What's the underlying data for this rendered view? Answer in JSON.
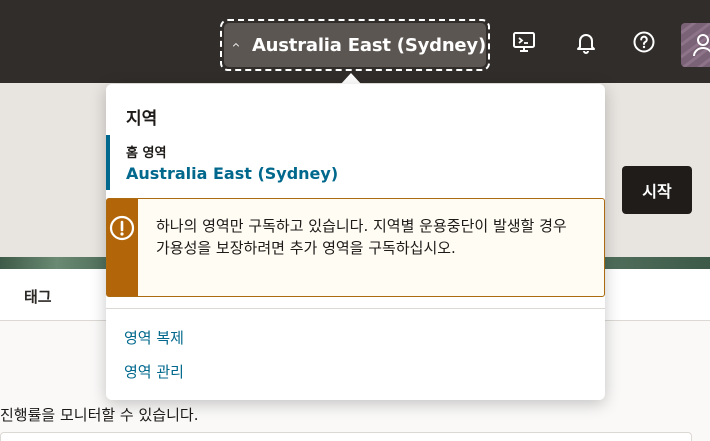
{
  "header": {
    "region_selector": {
      "label": "Australia East (Sydney)"
    },
    "icons": [
      "cloud-shell-icon",
      "bell-icon",
      "help-icon",
      "avatar"
    ]
  },
  "background": {
    "start_button": "시작",
    "tab_tags": "태그",
    "monitor_text": "진행률을 모니터할 수 있습니다."
  },
  "region_popover": {
    "title": "지역",
    "home_region_label": "홈 영역",
    "home_region_name": "Australia East (Sydney)",
    "warning": "하나의 영역만 구독하고 있습니다. 지역별 운용중단이 발생할 경우 가용성을 보장하려면 추가 영역을 구독하십시오.",
    "links": {
      "replicate": "영역 복제",
      "manage": "영역 관리"
    }
  },
  "colors": {
    "header_bg": "#312d2a",
    "link": "#00688c",
    "warning_accent": "#b36609",
    "warning_bg": "#fefcf3"
  }
}
